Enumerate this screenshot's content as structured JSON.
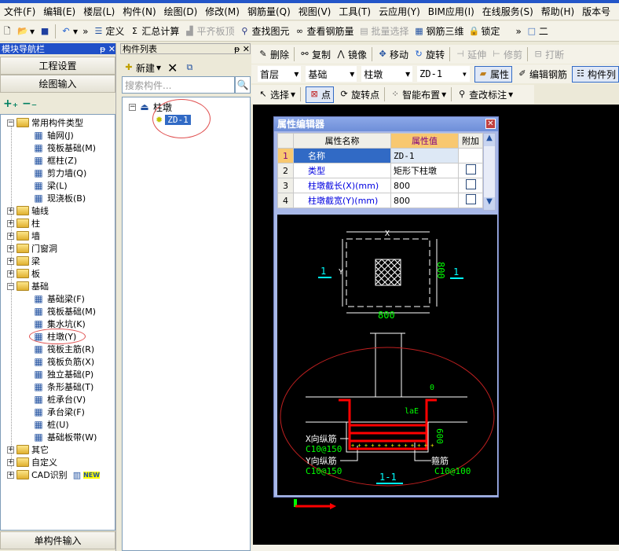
{
  "menu": [
    "文件(F)",
    "编辑(E)",
    "楼层(L)",
    "构件(N)",
    "绘图(D)",
    "修改(M)",
    "钢筋量(Q)",
    "视图(V)",
    "工具(T)",
    "云应用(Y)",
    "BIM应用(I)",
    "在线服务(S)",
    "帮助(H)",
    "版本号"
  ],
  "toolbar": {
    "define": "定义",
    "sum": "汇总计算",
    "level_slab": "平齐板顶",
    "find": "查找图元",
    "view_rebar": "查看钢筋量",
    "batch_select": "批量选择",
    "rebar_3d": "钢筋三维",
    "lock": "锁定",
    "more": "»",
    "two": "二"
  },
  "nav": {
    "title": "模块导航栏",
    "project_settings": "工程设置",
    "draw_input": "绘图输入",
    "single_input": "单构件输入",
    "tree": [
      {
        "label": "常用构件类型",
        "level": 0,
        "expanded": true
      },
      {
        "label": "轴网(J)",
        "level": 1,
        "icon": "grid-icon"
      },
      {
        "label": "筏板基础(M)",
        "level": 1,
        "icon": "raft-icon"
      },
      {
        "label": "框柱(Z)",
        "level": 1,
        "icon": "column-icon"
      },
      {
        "label": "剪力墙(Q)",
        "level": 1,
        "icon": "wall-icon"
      },
      {
        "label": "梁(L)",
        "level": 1,
        "icon": "beam-icon"
      },
      {
        "label": "现浇板(B)",
        "level": 1,
        "icon": "slab-icon"
      },
      {
        "label": "轴线",
        "level": 0
      },
      {
        "label": "柱",
        "level": 0
      },
      {
        "label": "墙",
        "level": 0
      },
      {
        "label": "门窗洞",
        "level": 0
      },
      {
        "label": "梁",
        "level": 0
      },
      {
        "label": "板",
        "level": 0
      },
      {
        "label": "基础",
        "level": 0,
        "expanded": true
      },
      {
        "label": "基础梁(F)",
        "level": 1,
        "icon": "foundation-beam-icon"
      },
      {
        "label": "筏板基础(M)",
        "level": 1,
        "icon": "raft-icon"
      },
      {
        "label": "集水坑(K)",
        "level": 1,
        "icon": "sump-icon"
      },
      {
        "label": "柱墩(Y)",
        "level": 1,
        "icon": "column-pier-icon",
        "circled": true
      },
      {
        "label": "筏板主筋(R)",
        "level": 1,
        "icon": "raft-main-rebar-icon"
      },
      {
        "label": "筏板负筋(X)",
        "level": 1,
        "icon": "raft-neg-rebar-icon"
      },
      {
        "label": "独立基础(P)",
        "level": 1,
        "icon": "isolated-footing-icon"
      },
      {
        "label": "条形基础(T)",
        "level": 1,
        "icon": "strip-footing-icon"
      },
      {
        "label": "桩承台(V)",
        "level": 1,
        "icon": "pile-cap-icon"
      },
      {
        "label": "承台梁(F)",
        "level": 1,
        "icon": "cap-beam-icon"
      },
      {
        "label": "桩(U)",
        "level": 1,
        "icon": "pile-icon"
      },
      {
        "label": "基础板带(W)",
        "level": 1,
        "icon": "slab-strip-icon"
      },
      {
        "label": "其它",
        "level": 0
      },
      {
        "label": "自定义",
        "level": 0
      },
      {
        "label": "CAD识别",
        "level": 0,
        "badge": "NEW"
      }
    ]
  },
  "components": {
    "title": "构件列表",
    "new": "新建",
    "search_placeholder": "搜索构件...",
    "group": "柱墩",
    "item": "ZD-1"
  },
  "edit_toolbar": {
    "delete": "删除",
    "copy": "复制",
    "mirror": "镜像",
    "move": "移动",
    "rotate": "旋转",
    "extend": "延伸",
    "trim": "修剪",
    "break": "打断"
  },
  "selectors": {
    "floor": "首层",
    "category": "基础",
    "type": "柱墩",
    "name": "ZD-1",
    "properties": "属性",
    "edit_rebar": "编辑钢筋",
    "component_list": "构件列"
  },
  "draw_toolbar": {
    "select": "选择",
    "point": "点",
    "rotate_point": "旋转点",
    "smart_layout": "智能布置",
    "edit_label": "查改标注"
  },
  "property_editor": {
    "title": "属性编辑器",
    "headers": [
      "属性名称",
      "属性值",
      "附加"
    ],
    "rows": [
      {
        "no": "1",
        "name": "名称",
        "value": "ZD-1"
      },
      {
        "no": "2",
        "name": "类型",
        "value": "矩形下柱墩"
      },
      {
        "no": "3",
        "name": "柱墩截长(X)(mm)",
        "value": "800"
      },
      {
        "no": "4",
        "name": "柱墩截宽(Y)(mm)",
        "value": "800"
      }
    ]
  },
  "diagram": {
    "x": "X",
    "y": "Y",
    "dim_x": "800",
    "dim_y": "800",
    "sec_left": "1",
    "sec_right": "1",
    "zero": "0",
    "lae": "laE",
    "depth": "600",
    "x_rebar": "X向纵筋",
    "x_rebar_spec": "C10@150",
    "y_rebar": "Y向纵筋",
    "y_rebar_spec": "C10@150",
    "stirrup": "箍筋",
    "stirrup_spec": "C10@100",
    "section": "1-1"
  },
  "colors": {
    "accent": "#2050c8",
    "drawing_green": "#00ff00",
    "drawing_cyan": "#00ffff",
    "rebar_red": "#ff0000"
  }
}
